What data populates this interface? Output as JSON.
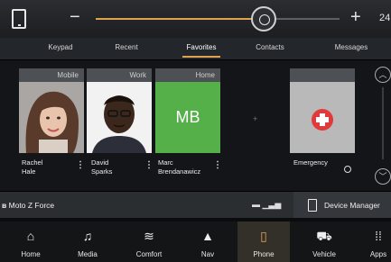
{
  "volume": {
    "level": 24,
    "fraction": 0.69
  },
  "tabs": [
    "Keypad",
    "Recent",
    "Favorites",
    "Contacts",
    "Messages"
  ],
  "active_tab": "Favorites",
  "favorites": [
    {
      "type": "Mobile",
      "first": "Rachel",
      "last": "Hale"
    },
    {
      "type": "Work",
      "first": "David",
      "last": "Sparks"
    },
    {
      "type": "Home",
      "first": "Marc",
      "last": "Brendanawicz",
      "initials": "MB"
    }
  ],
  "emergency_label": "Emergency",
  "bluetooth_device": "Moto Z Force",
  "device_manager": "Device Manager",
  "nav": [
    {
      "label": "Home",
      "icon": "home-icon"
    },
    {
      "label": "Media",
      "icon": "music-icon"
    },
    {
      "label": "Comfort",
      "icon": "seat-heat-icon"
    },
    {
      "label": "Nav",
      "icon": "navigation-icon"
    },
    {
      "label": "Phone",
      "icon": "phone-icon"
    },
    {
      "label": "Vehicle",
      "icon": "car-icon"
    },
    {
      "label": "Apps",
      "icon": "apps-icon"
    }
  ],
  "active_nav": "Phone",
  "colors": {
    "accent": "#e0a24e",
    "mb_tile": "#56b04a",
    "emergency_red": "#e13a3a"
  }
}
